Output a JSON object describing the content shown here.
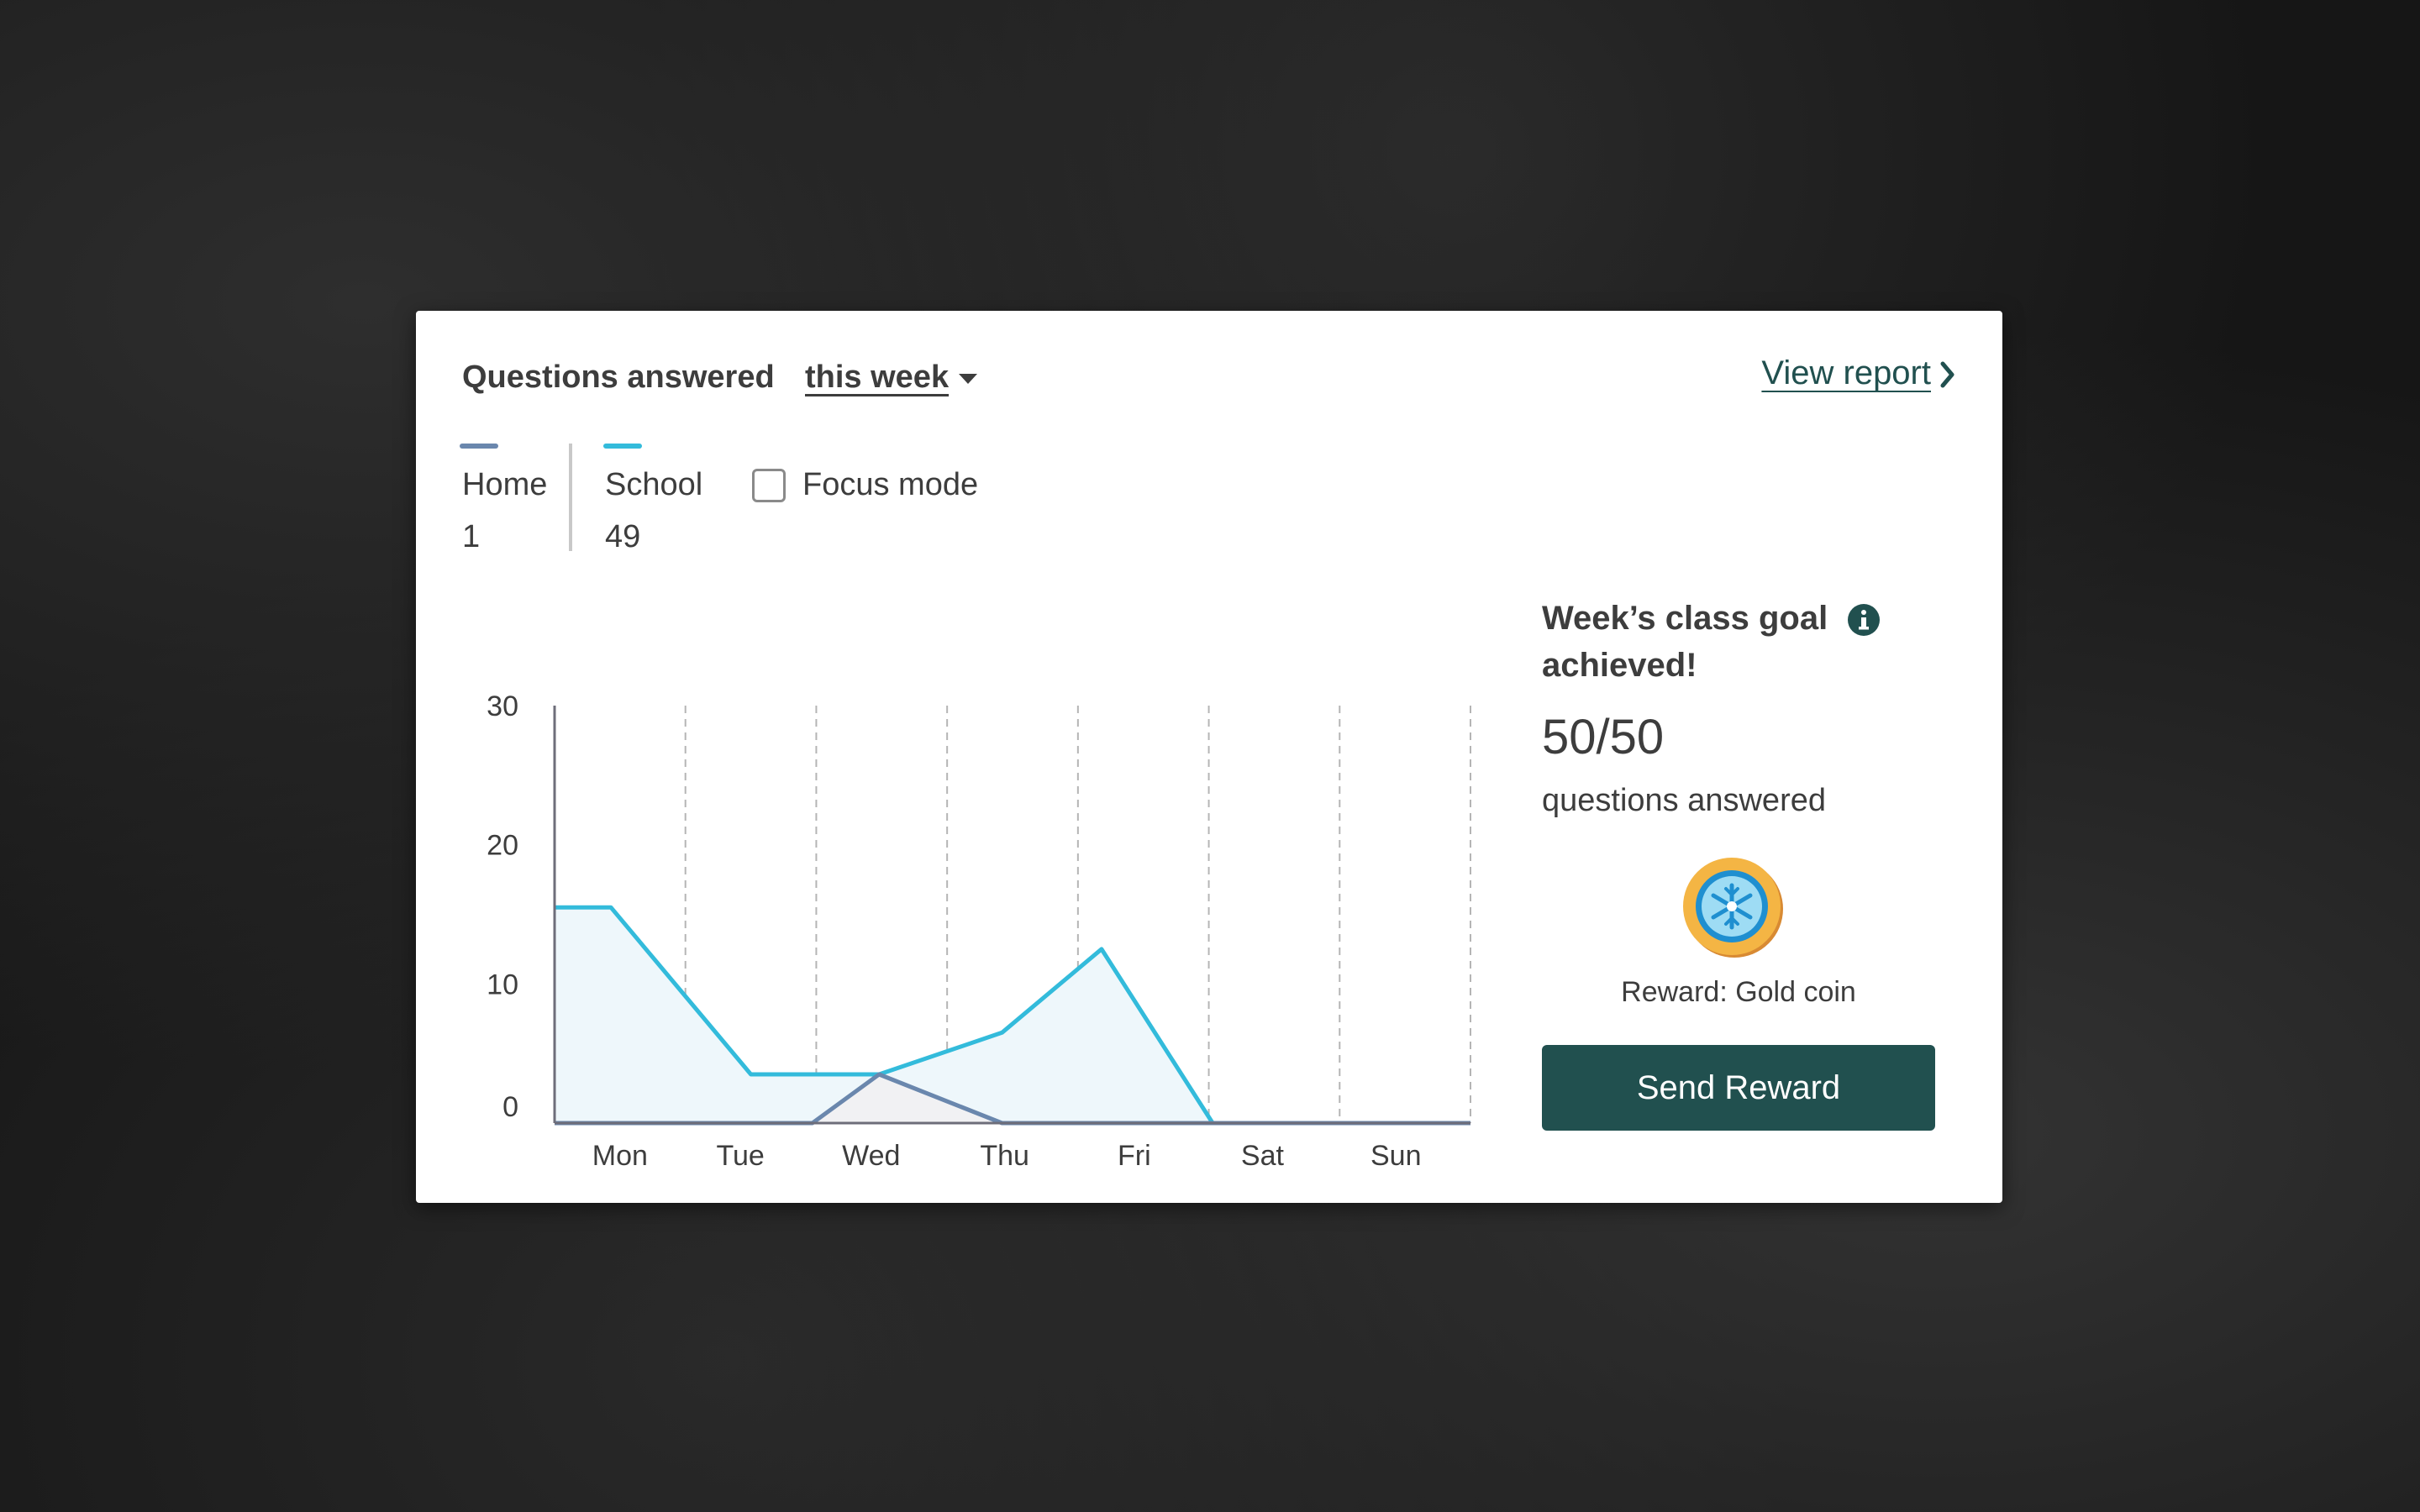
{
  "header": {
    "title": "Questions answered",
    "period_select": {
      "selected": "this week"
    },
    "view_report_label": "View report"
  },
  "legend": {
    "items": [
      {
        "label": "Home",
        "value": "1",
        "color": "#6a87ad"
      },
      {
        "label": "School",
        "value": "49",
        "color": "#33bbdb"
      }
    ],
    "focus_mode": {
      "label": "Focus mode",
      "checked": false
    }
  },
  "chart_data": {
    "type": "area",
    "categories": [
      "Mon",
      "Tue",
      "Wed",
      "Thu",
      "Fri",
      "Sat",
      "Sun"
    ],
    "x_positions": [
      0,
      0.43,
      1.5,
      1.97,
      2.48,
      3.42,
      4.18,
      5.03,
      5.5,
      6.05,
      6.45,
      7
    ],
    "series": [
      {
        "name": "School",
        "color": "#33bbdb",
        "fill": "#eef7fb",
        "values": [
          15.5,
          15.5,
          3.5,
          3.5,
          3.5,
          6.5,
          12.5,
          0,
          0,
          0,
          0,
          0
        ]
      },
      {
        "name": "Home",
        "color": "#6a87ad",
        "fill": "#f1f1f3",
        "values": [
          0,
          0,
          0,
          0,
          3.5,
          0,
          0,
          0,
          0,
          0,
          0,
          0
        ]
      }
    ],
    "yticks": [
      0,
      10,
      20,
      30
    ],
    "ylim": [
      0,
      30
    ],
    "grid": "vertical-dashed"
  },
  "goal": {
    "title": "Week’s class goal achieved!",
    "score": "50/50",
    "caption": "questions answered",
    "reward_text": "Reward: Gold coin",
    "button_label": "Send Reward"
  }
}
